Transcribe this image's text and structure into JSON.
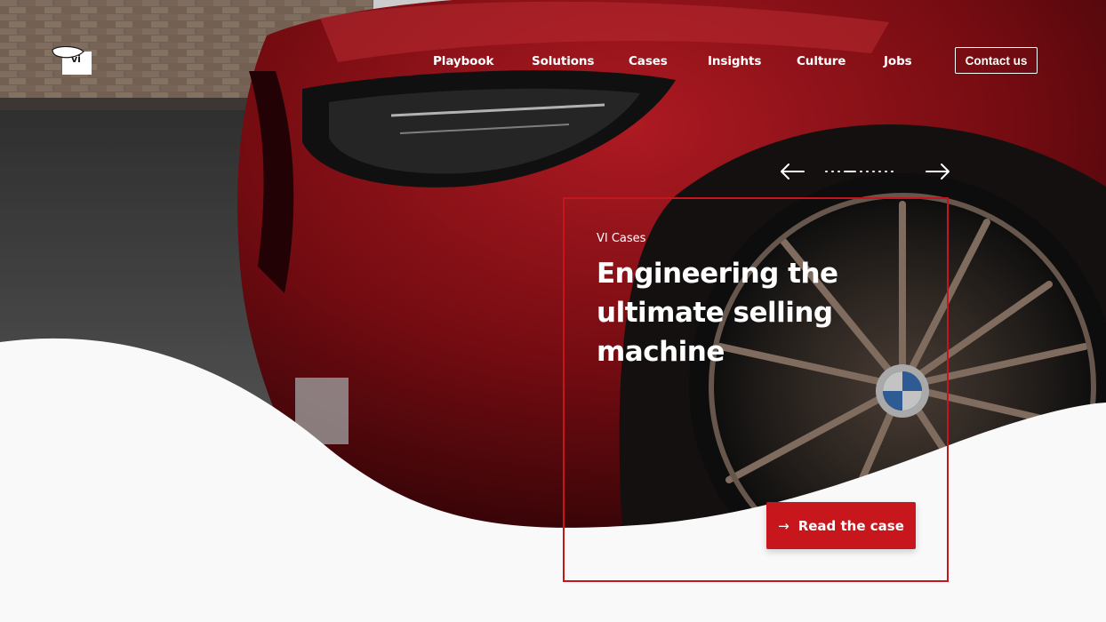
{
  "brand": {
    "logo_text": "vi",
    "logo_icon": "vi-logo-icon"
  },
  "nav": {
    "items": [
      "Playbook",
      "Solutions",
      "Cases",
      "Insights",
      "Culture",
      "Jobs"
    ],
    "contact_label": "Contact us"
  },
  "slider": {
    "prev_icon": "arrow-left-icon",
    "next_icon": "arrow-right-icon",
    "total_slides": 10,
    "active_slide": 3
  },
  "case": {
    "label": "VI Cases",
    "title": "Engineering the ultimate selling machine",
    "cta_label": "Read the case",
    "cta_icon": "arrow-right-icon"
  },
  "colors": {
    "accent": "#c8161d",
    "background": "#f9f9f9"
  }
}
